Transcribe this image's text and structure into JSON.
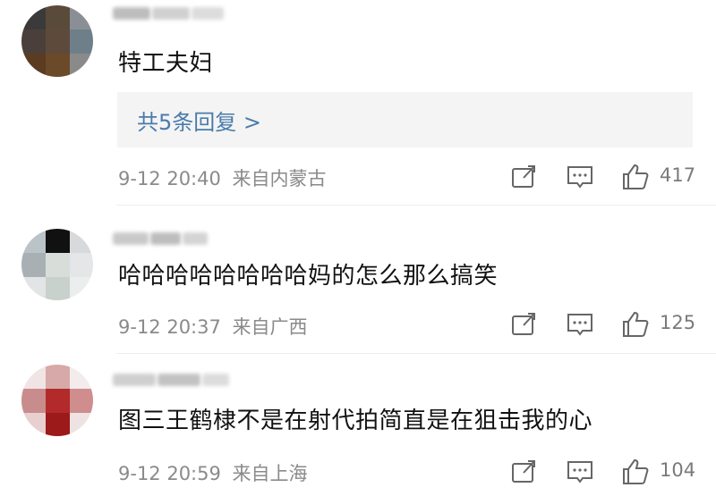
{
  "comments": [
    {
      "content": "特工夫妇",
      "reply_link": "共5条回复 >",
      "date": "9-12 20:40",
      "location": "来自内蒙古",
      "likes": "417"
    },
    {
      "content": "哈哈哈哈哈哈哈哈妈的怎么那么搞笑",
      "date": "9-12 20:37",
      "location": "来自广西",
      "likes": "125"
    },
    {
      "content": "图三王鹤棣不是在射代拍简直是在狙击我的心",
      "date": "9-12 20:59",
      "location": "来自上海",
      "likes": "104"
    }
  ],
  "icons": {
    "share": "share-icon",
    "comment": "comment-icon",
    "like": "thumbs-up-icon"
  }
}
